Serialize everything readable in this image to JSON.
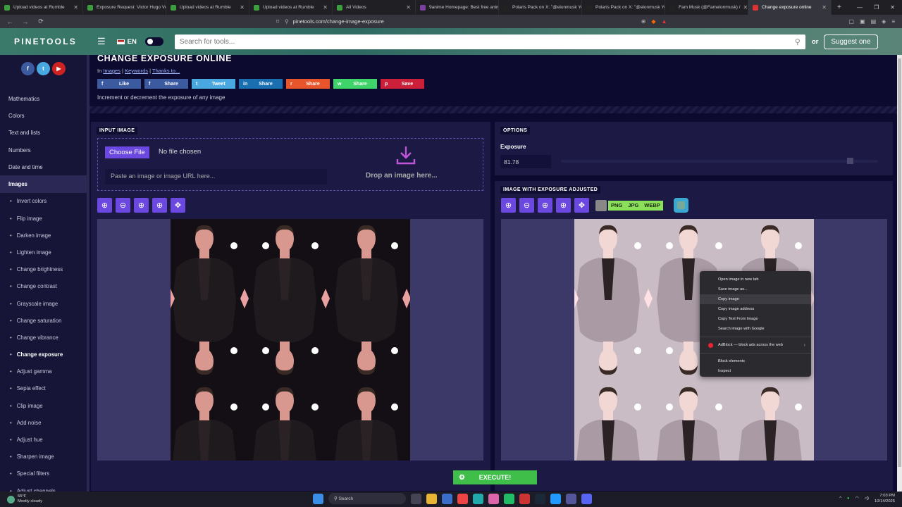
{
  "browser": {
    "tabs": [
      {
        "title": "Upload videos at Rumble",
        "color": "#3c9e3c"
      },
      {
        "title": "Exposure Request: Victor Hugo Vo",
        "color": "#3c9e3c"
      },
      {
        "title": "Upload videos at Rumble",
        "color": "#3c9e3c"
      },
      {
        "title": "Upload videos at Rumble",
        "color": "#3c9e3c"
      },
      {
        "title": "All Videos",
        "color": "#3c9e3c"
      },
      {
        "title": "9anime Homepage: Best free anim",
        "color": "#7b3fa0"
      },
      {
        "title": "Polaris Pack on X: \"@elonmusk Yo",
        "color": "#222"
      },
      {
        "title": "Polaris Pack on X: \"@elonmusk Yo",
        "color": "#222"
      },
      {
        "title": "Fam Musk (@Famelonmusk) /",
        "color": "#222"
      },
      {
        "title": "Change exposure online",
        "color": "#d33"
      }
    ],
    "url": "pinetools.com/change-image-exposure"
  },
  "header": {
    "logo": "PINETOOLS",
    "lang": "EN",
    "search_placeholder": "Search for tools...",
    "or": "or",
    "suggest": "Suggest one"
  },
  "sidebar": {
    "socials": [
      "f",
      "t",
      "▶"
    ],
    "categories": [
      "Mathematics",
      "Colors",
      "Text and lists",
      "Numbers",
      "Date and time",
      "Images"
    ],
    "active_category": "Images",
    "tools": [
      "Invert colors",
      "Flip image",
      "Darken image",
      "Lighten image",
      "Change brightness",
      "Change contrast",
      "Grayscale image",
      "Change saturation",
      "Change vibrance",
      "Change exposure",
      "Adjust gamma",
      "Sepia effect",
      "Clip image",
      "Add noise",
      "Adjust hue",
      "Sharpen image",
      "Special filters",
      "Adjust channels"
    ],
    "active_tool": "Change exposure"
  },
  "page": {
    "title": "CHANGE EXPOSURE ONLINE",
    "crumbs_in": "In",
    "crumb_images": "Images",
    "crumb_keywords": "Keywords",
    "crumb_thanks": "Thanks to...",
    "description": "Increment or decrement the exposure of any image",
    "share_buttons": [
      {
        "label": "Like",
        "icon": "f",
        "color": "#3b5aa0"
      },
      {
        "label": "Share",
        "icon": "f",
        "color": "#3b5aa0"
      },
      {
        "label": "Tweet",
        "icon": "t",
        "color": "#4aa8e0"
      },
      {
        "label": "Share",
        "icon": "in",
        "color": "#1a6fb0"
      },
      {
        "label": "Share",
        "icon": "r",
        "color": "#e8552a"
      },
      {
        "label": "Share",
        "icon": "w",
        "color": "#3fd46a"
      },
      {
        "label": "Save",
        "icon": "p",
        "color": "#cc1f3a"
      }
    ]
  },
  "input_panel": {
    "heading": "INPUT IMAGE",
    "choose_file": "Choose File",
    "no_file": "No file chosen",
    "paste_placeholder": "Paste an image or image URL here...",
    "drop_text": "Drop an image here..."
  },
  "options_panel": {
    "heading": "OPTIONS",
    "exposure_label": "Exposure",
    "exposure_value": "81.78",
    "slider_fraction": 0.91
  },
  "output_panel": {
    "heading": "IMAGE WITH EXPOSURE ADJUSTED",
    "formats": [
      "PNG",
      "JPG",
      "WEBP"
    ]
  },
  "execute_label": "EXECUTE!",
  "context_menu": {
    "items": [
      "Open image in new tab",
      "Save image as...",
      "Copy image",
      "Copy image address",
      "Copy Text From Image",
      "Search image with Google"
    ],
    "hovered": "Copy image",
    "adblock": "AdBlock — block ads across the web",
    "extra": [
      "Block elements",
      "Inspect"
    ]
  },
  "taskbar": {
    "weather_temp": "55°F",
    "weather_desc": "Mostly cloudy",
    "search": "Search",
    "time": "7:03 PM",
    "date": "10/14/2025"
  }
}
